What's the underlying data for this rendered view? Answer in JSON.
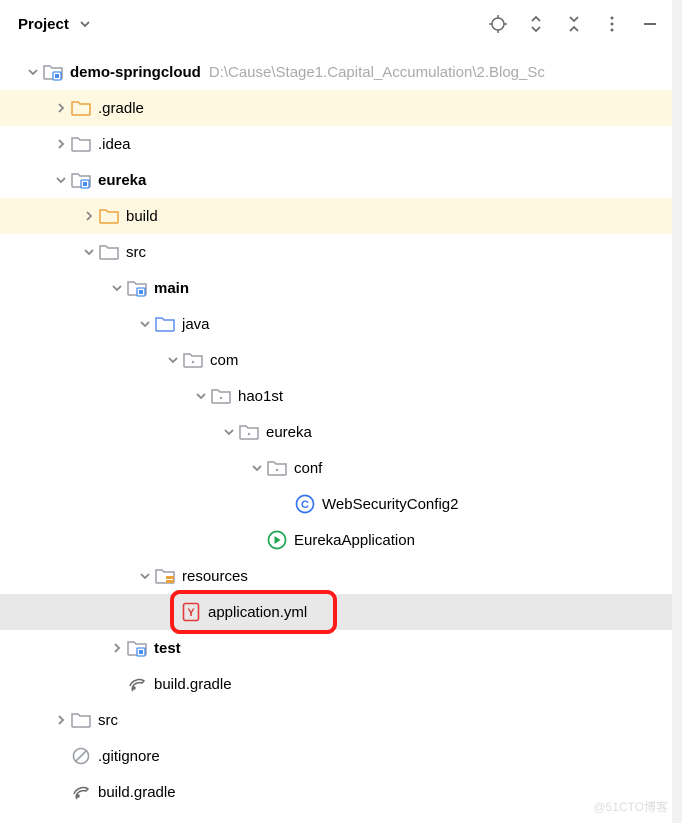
{
  "header": {
    "title": "Project"
  },
  "tree": {
    "root": {
      "name": "demo-springcloud",
      "path": "D:\\Cause\\Stage1.Capital_Accumulation\\2.Blog_Sc"
    },
    "gradle_dir": ".gradle",
    "idea_dir": ".idea",
    "eureka": "eureka",
    "build": "build",
    "src": "src",
    "main": "main",
    "java": "java",
    "com": "com",
    "hao1st": "hao1st",
    "eureka_pkg": "eureka",
    "conf": "conf",
    "web_security": "WebSecurityConfig2",
    "eureka_app": "EurekaApplication",
    "resources": "resources",
    "app_yml": "application.yml",
    "test": "test",
    "build_gradle": "build.gradle",
    "src2": "src",
    "gitignore": ".gitignore",
    "build_gradle2": "build.gradle"
  },
  "watermark": "@51CTO博客"
}
